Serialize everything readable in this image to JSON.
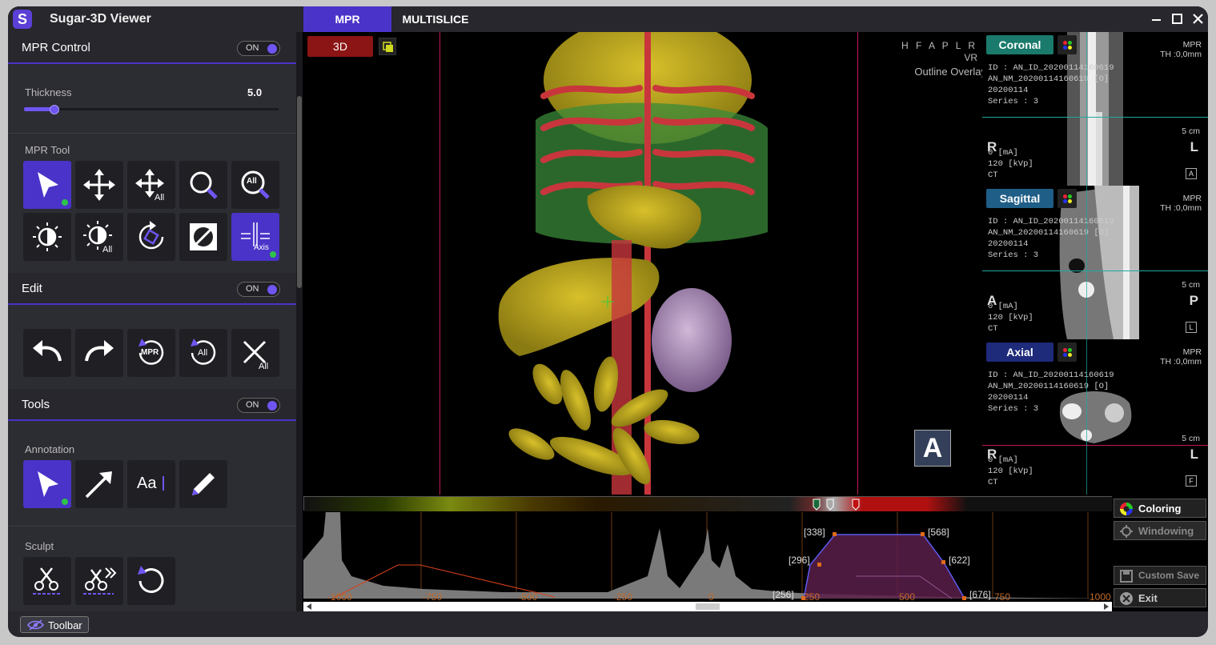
{
  "app": {
    "logo": "S",
    "title": "Sugar-3D Viewer"
  },
  "tabs": [
    {
      "label": "MPR"
    },
    {
      "label": "MULTISLICE"
    }
  ],
  "window_controls": {
    "minimize": "minimize-icon",
    "maximize": "maximize-icon",
    "close": "close-icon"
  },
  "left_panel": {
    "mpr_control": {
      "title": "MPR Control",
      "toggle": "ON"
    },
    "thickness": {
      "label": "Thickness",
      "value": "5.0",
      "slider_fraction": 0.12
    },
    "mpr_tool": {
      "label": "MPR Tool",
      "tools": [
        {
          "icon": "cursor-icon",
          "selected": true
        },
        {
          "icon": "move-icon",
          "selected": false
        },
        {
          "icon": "move-all-icon",
          "text": "All",
          "selected": false
        },
        {
          "icon": "zoom-icon",
          "selected": false
        },
        {
          "icon": "zoom-all-icon",
          "text": "All",
          "selected": false
        },
        {
          "icon": "window-level-icon",
          "selected": false
        },
        {
          "icon": "window-level-all-icon",
          "text": "All",
          "selected": false
        },
        {
          "icon": "rotate-icon",
          "selected": false
        },
        {
          "icon": "invert-icon",
          "selected": false
        },
        {
          "icon": "axis-icon",
          "text": "Axis",
          "selected": true
        }
      ]
    },
    "edit": {
      "title": "Edit",
      "toggle": "ON",
      "tools": [
        {
          "icon": "undo-icon"
        },
        {
          "icon": "redo-icon"
        },
        {
          "icon": "reset-mpr-icon",
          "text": "MPR"
        },
        {
          "icon": "reset-all-icon",
          "text": "All"
        },
        {
          "icon": "clear-all-icon",
          "text": "All"
        }
      ]
    },
    "tools": {
      "title": "Tools",
      "toggle": "ON"
    },
    "annotation": {
      "label": "Annotation",
      "tools": [
        {
          "icon": "cursor-icon",
          "selected": true
        },
        {
          "icon": "arrow-icon"
        },
        {
          "icon": "text-icon",
          "text": "Aa"
        },
        {
          "icon": "pencil-icon"
        }
      ]
    },
    "sculpt": {
      "label": "Sculpt",
      "tools": [
        {
          "icon": "scissors-icon"
        },
        {
          "icon": "scissors-fast-icon"
        },
        {
          "icon": "reset-icon"
        }
      ]
    }
  },
  "bottom": {
    "toolbar_label": "Toolbar"
  },
  "viewer3d": {
    "mode_button": "3D",
    "orientation": "H F A P L R",
    "render_mode": "VR",
    "overlay": "Outline Overlay",
    "orientation_cube": "A"
  },
  "panels": [
    {
      "name": "Coronal",
      "color": "#1a7a6c",
      "mode": "MPR",
      "thickness": "TH :0,0mm",
      "id": "ID : AN_ID_20200114160619",
      "nm": "AN_NM_20200114160619 [O]",
      "date": "20200114",
      "series": "Series : 3",
      "scale": "5 cm",
      "left": "R",
      "right": "L",
      "box": "A",
      "ma": "0  [mA]",
      "kvp": "120  [kVp]",
      "mod": "CT",
      "line_color": "#1fa8a0"
    },
    {
      "name": "Sagittal",
      "color": "#1f5e87",
      "mode": "MPR",
      "thickness": "TH :0,0mm",
      "id": "ID : AN_ID_20200114160619",
      "nm": "AN_NM_20200114160619 [O]",
      "date": "20200114",
      "series": "Series : 3",
      "scale": "5 cm",
      "left": "A",
      "right": "P",
      "box": "L",
      "ma": "0  [mA]",
      "kvp": "120  [kVp]",
      "mod": "CT",
      "line_color": "#1fa8a0"
    },
    {
      "name": "Axial",
      "color": "#1e2a7a",
      "mode": "MPR",
      "thickness": "TH :0,0mm",
      "id": "ID : AN_ID_20200114160619",
      "nm": "AN_NM_20200114160619 [O]",
      "date": "20200114",
      "series": "Series : 3",
      "scale": "5 cm",
      "left": "R",
      "right": "L",
      "box": "F",
      "ma": "0  [mA]",
      "kvp": "120  [kVp]",
      "mod": "CT",
      "line_color": "#c2185b"
    }
  ],
  "histogram": {
    "axis_ticks": [
      "-1000",
      "-750",
      "-500",
      "-250",
      "0",
      "250",
      "500",
      "750",
      "1000"
    ],
    "points": [
      "[338]",
      "[568]",
      "[296]",
      "[622]",
      "[256]",
      "[676]"
    ]
  },
  "side_buttons": [
    {
      "label": "Coloring",
      "icon": "color-wheel-icon"
    },
    {
      "label": "Windowing",
      "icon": "windowing-icon"
    },
    {
      "label": "Custom Save",
      "icon": "save-icon"
    },
    {
      "label": "Exit",
      "icon": "exit-icon"
    }
  ]
}
